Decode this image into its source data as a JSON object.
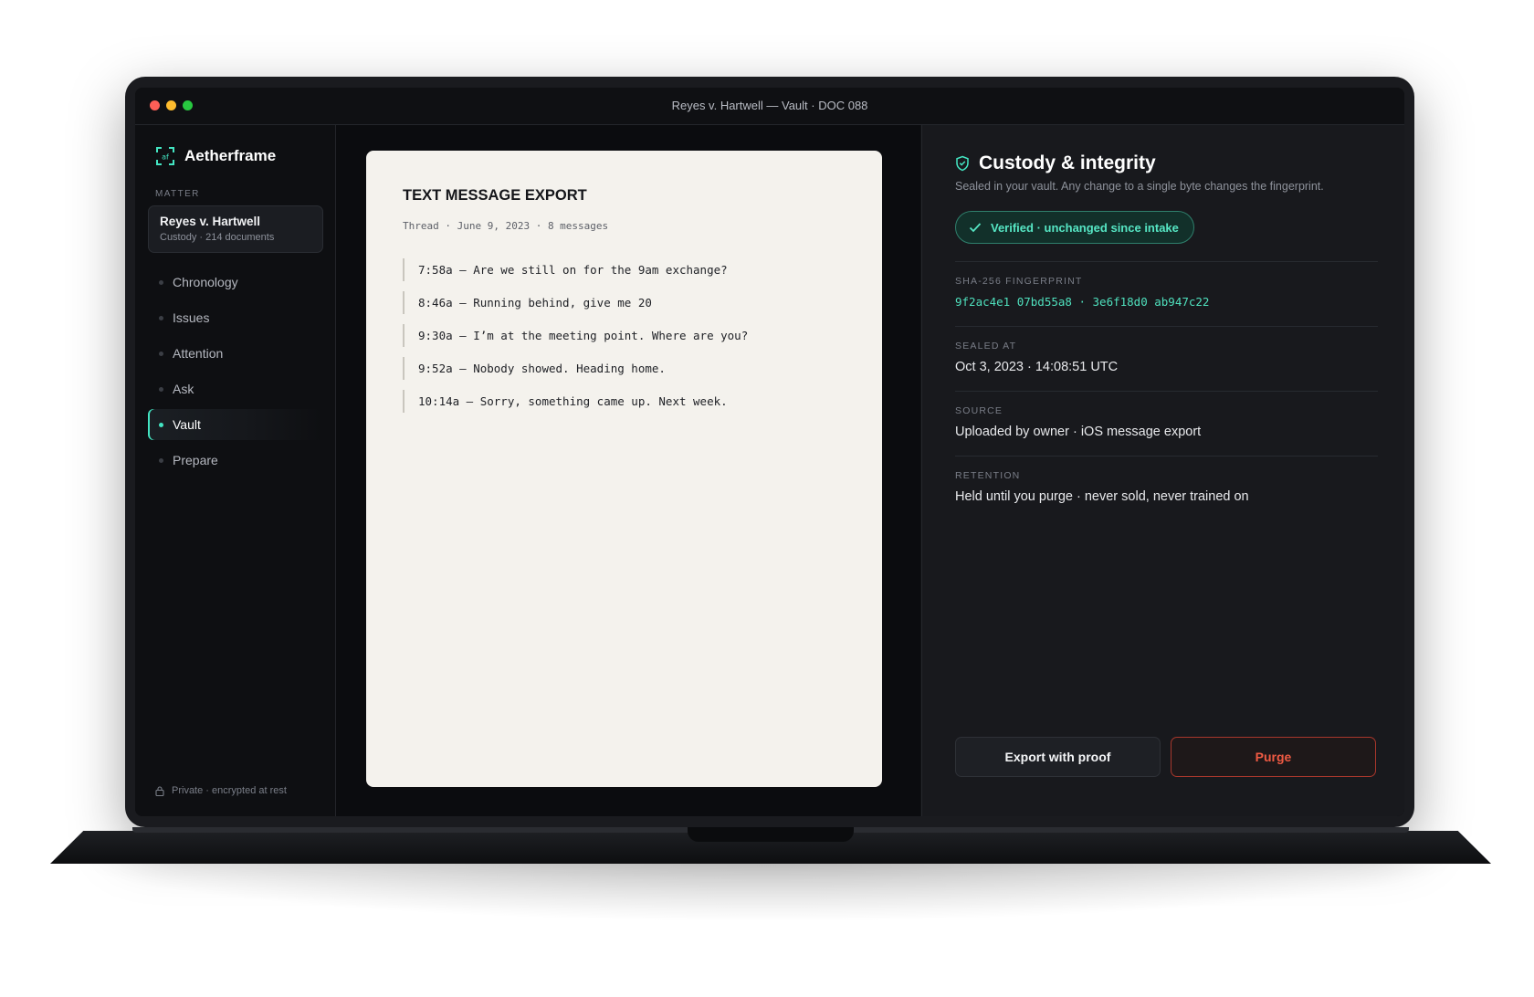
{
  "window": {
    "title": "Reyes v. Hartwell — Vault · DOC 088"
  },
  "brand": {
    "name": "Aetherframe",
    "icon": "frame-logo-icon",
    "accent": "#43e5c2"
  },
  "sidebar": {
    "section_label": "MATTER",
    "matter": {
      "name": "Reyes v. Hartwell",
      "subtitle": "Custody · 214 documents"
    },
    "items": [
      {
        "label": "Chronology",
        "active": false
      },
      {
        "label": "Issues",
        "active": false
      },
      {
        "label": "Attention",
        "active": false
      },
      {
        "label": "Ask",
        "active": false
      },
      {
        "label": "Vault",
        "active": true
      },
      {
        "label": "Prepare",
        "active": false
      }
    ],
    "footer": "Private · encrypted at rest"
  },
  "document": {
    "title": "TEXT MESSAGE EXPORT",
    "meta": "Thread · June 9, 2023 · 8 messages",
    "messages": [
      "7:58a — Are we still on for the 9am exchange?",
      "8:46a — Running behind, give me 20",
      "9:30a — I’m at the meeting point. Where are you?",
      "9:52a — Nobody showed. Heading home.",
      "10:14a — Sorry, something came up. Next week."
    ]
  },
  "panel": {
    "title": "Custody & integrity",
    "subtitle": "Sealed in your vault. Any change to a single byte changes the fingerprint.",
    "status_badge": "Verified · unchanged since intake",
    "fields": [
      {
        "label": "SHA-256 FINGERPRINT",
        "value": "9f2ac4e1 07bd55a8 · 3e6f18d0 ab947c22"
      },
      {
        "label": "SEALED AT",
        "value": "Oct 3, 2023 · 14:08:51 UTC"
      },
      {
        "label": "SOURCE",
        "value": "Uploaded by owner · iOS message export"
      },
      {
        "label": "RETENTION",
        "value": "Held until you purge · never sold, never trained on"
      }
    ],
    "export_label": "Export with proof",
    "purge_label": "Purge",
    "colors": {
      "verified": "#56e6c4",
      "danger": "#ef5a43"
    }
  }
}
